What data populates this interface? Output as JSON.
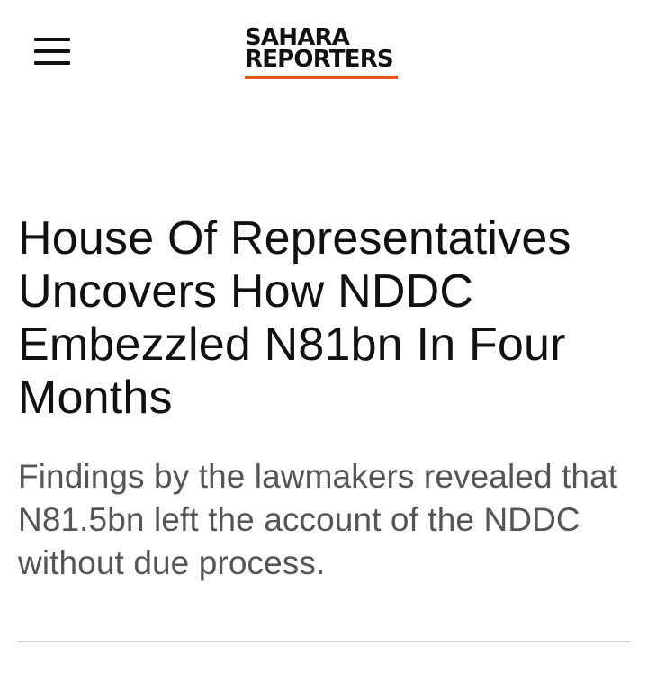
{
  "header": {
    "menu_icon": "hamburger-menu-icon",
    "logo": {
      "line1": "SAHARA",
      "line2": "REPORTERS",
      "accent_color": "#e8561c"
    }
  },
  "article": {
    "headline": "House Of Representatives Uncovers How NDDC Embezzled N81bn In Four Months",
    "summary": "Findings by the lawmakers revealed that N81.5bn left the account of the NDDC without due process."
  },
  "colors": {
    "text": "#111111",
    "summary_text": "#555555",
    "divider": "#cfcfcf",
    "background": "#ffffff"
  }
}
